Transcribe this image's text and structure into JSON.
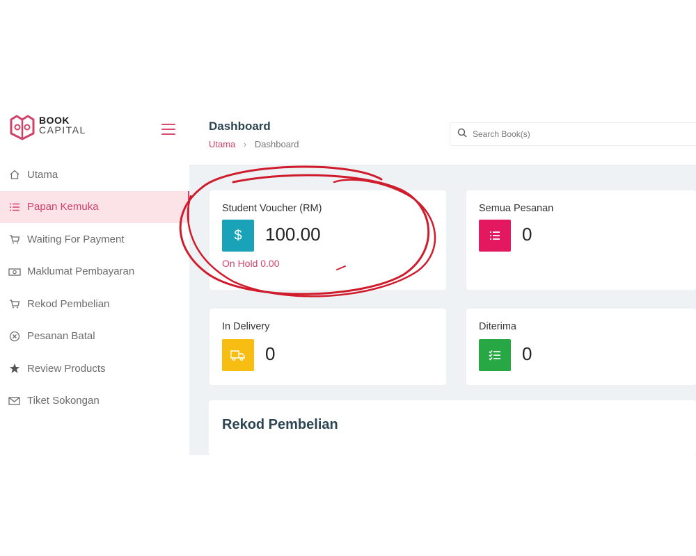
{
  "brand": {
    "line1": "BOOK",
    "line2": "CAPITAL"
  },
  "sidebar": {
    "items": [
      {
        "label": "Utama",
        "icon": "home-icon"
      },
      {
        "label": "Papan Kemuka",
        "icon": "list-icon",
        "active": true
      },
      {
        "label": "Waiting For Payment",
        "icon": "cart-icon"
      },
      {
        "label": "Maklumat Pembayaran",
        "icon": "cash-icon"
      },
      {
        "label": "Rekod Pembelian",
        "icon": "cart-icon"
      },
      {
        "label": "Pesanan Batal",
        "icon": "cancel-circle-icon"
      },
      {
        "label": "Review Products",
        "icon": "star-icon"
      },
      {
        "label": "Tiket Sokongan",
        "icon": "mail-icon"
      }
    ]
  },
  "header": {
    "title": "Dashboard",
    "breadcrumb": {
      "home": "Utama",
      "current": "Dashboard"
    },
    "search_placeholder": "Search Book(s)"
  },
  "cards": {
    "voucher": {
      "label": "Student Voucher (RM)",
      "value": "100.00",
      "sub": "On Hold 0.00",
      "icon": "dollar-icon",
      "color": "#1aa3b8"
    },
    "orders": {
      "label": "Semua Pesanan",
      "value": "0",
      "icon": "list-icon",
      "color": "#e4185f"
    },
    "delivery": {
      "label": "In Delivery",
      "value": "0",
      "icon": "truck-icon",
      "color": "#f7bd12"
    },
    "received": {
      "label": "Diterima",
      "value": "0",
      "icon": "checklist-icon",
      "color": "#27a844"
    }
  },
  "section": {
    "title": "Rekod Pembelian"
  },
  "colors": {
    "accent": "#d0426a",
    "annotation": "#cf1b2b"
  }
}
